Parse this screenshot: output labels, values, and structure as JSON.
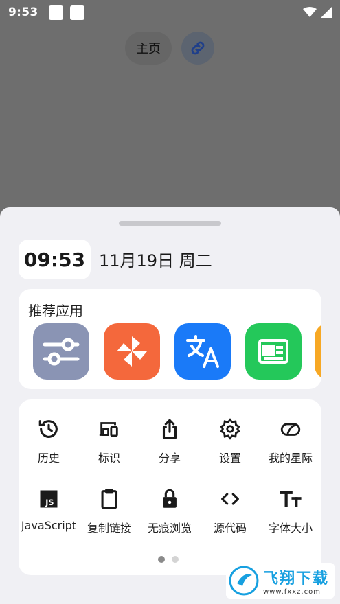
{
  "status_bar": {
    "time": "9:53"
  },
  "top": {
    "home_label": "主页"
  },
  "sheet": {
    "clock": "09:53",
    "date": "11月19日 周二",
    "recommended": {
      "title": "推荐应用",
      "apps": [
        {
          "icon": "sliders-icon",
          "color": "#8a94b4"
        },
        {
          "icon": "pinwheel-icon",
          "color": "#f4683c"
        },
        {
          "icon": "translate-icon",
          "color": "#1a7af8"
        },
        {
          "icon": "news-icon",
          "color": "#24c85a"
        },
        {
          "icon": "app-icon",
          "color": "#f7a824"
        }
      ]
    },
    "tools": [
      {
        "label": "历史",
        "icon": "history-icon"
      },
      {
        "label": "标识",
        "icon": "devices-icon"
      },
      {
        "label": "分享",
        "icon": "share-icon"
      },
      {
        "label": "设置",
        "icon": "gear-icon"
      },
      {
        "label": "我的星际",
        "icon": "planet-icon"
      },
      {
        "label": "JavaScript",
        "icon": "js-icon"
      },
      {
        "label": "复制链接",
        "icon": "clipboard-icon"
      },
      {
        "label": "无痕浏览",
        "icon": "lock-icon"
      },
      {
        "label": "源代码",
        "icon": "code-icon"
      },
      {
        "label": "字体大小",
        "icon": "font-size-icon"
      }
    ],
    "pager": {
      "pages": 2,
      "current": 1
    }
  },
  "watermark": {
    "title": "飞翔下载",
    "url": "www.fxxz.com"
  }
}
